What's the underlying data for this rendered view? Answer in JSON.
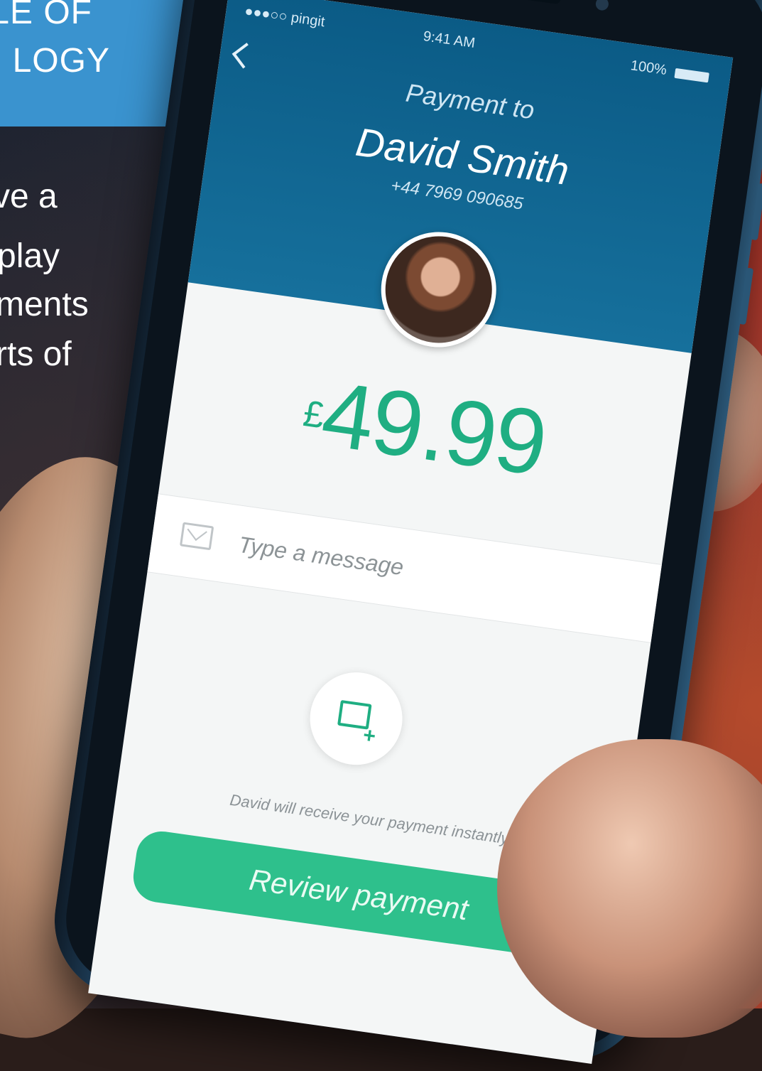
{
  "headline": {
    "line1": "LE OF",
    "line2": "LOGY"
  },
  "body_lines": [
    "ve a",
    "play",
    "ments",
    "rts of"
  ],
  "status_bar": {
    "carrier": "●●●○○ pingit",
    "time": "9:41 AM",
    "battery": "100%"
  },
  "payment": {
    "title": "Payment to",
    "payee_name": "David Smith",
    "payee_phone": "+44 7969 090685",
    "currency_symbol": "£",
    "amount": "49.99"
  },
  "message": {
    "placeholder": "Type a message"
  },
  "note": "David will receive your payment instantly",
  "review_button": "Review payment",
  "colors": {
    "header_blue": "#0b5b86",
    "amount_green": "#1fae82",
    "button_green": "#2ec08c",
    "headline_box_blue": "#3a93cf"
  }
}
